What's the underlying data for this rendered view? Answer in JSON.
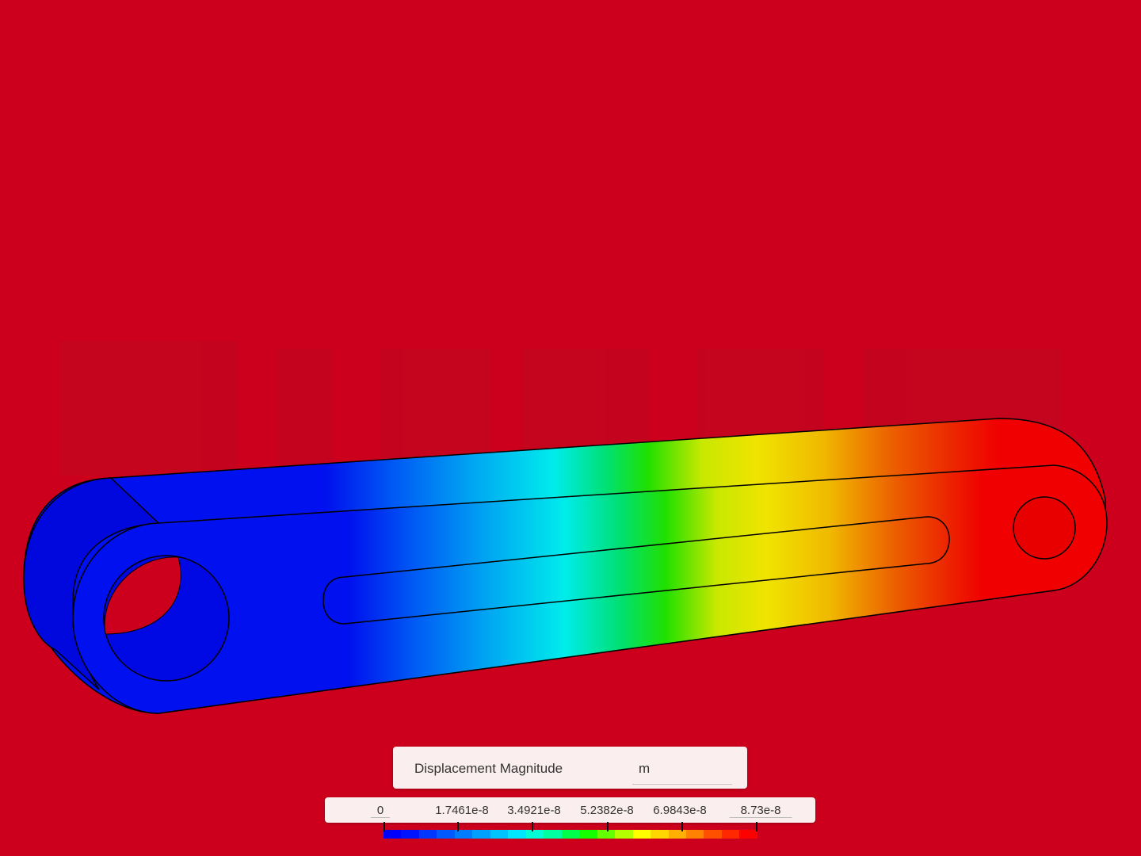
{
  "legend": {
    "title": "Displacement Magnitude",
    "unit": "m",
    "tick_labels": [
      "0",
      "1.7461e-8",
      "3.4921e-8",
      "5.2382e-8",
      "6.9843e-8",
      "8.73e-8"
    ],
    "colors": [
      "#0000ff",
      "#0014ff",
      "#0037ff",
      "#005aff",
      "#007dff",
      "#00a0ff",
      "#00c3ff",
      "#00e6ff",
      "#00ffd7",
      "#00ffa0",
      "#00ff4b",
      "#14ff00",
      "#64ff00",
      "#b4ff00",
      "#ffff00",
      "#ffd700",
      "#ffaf00",
      "#ff8200",
      "#ff5000",
      "#ff2800",
      "#ff0000"
    ]
  },
  "colors": {
    "background": "#cc001c"
  }
}
